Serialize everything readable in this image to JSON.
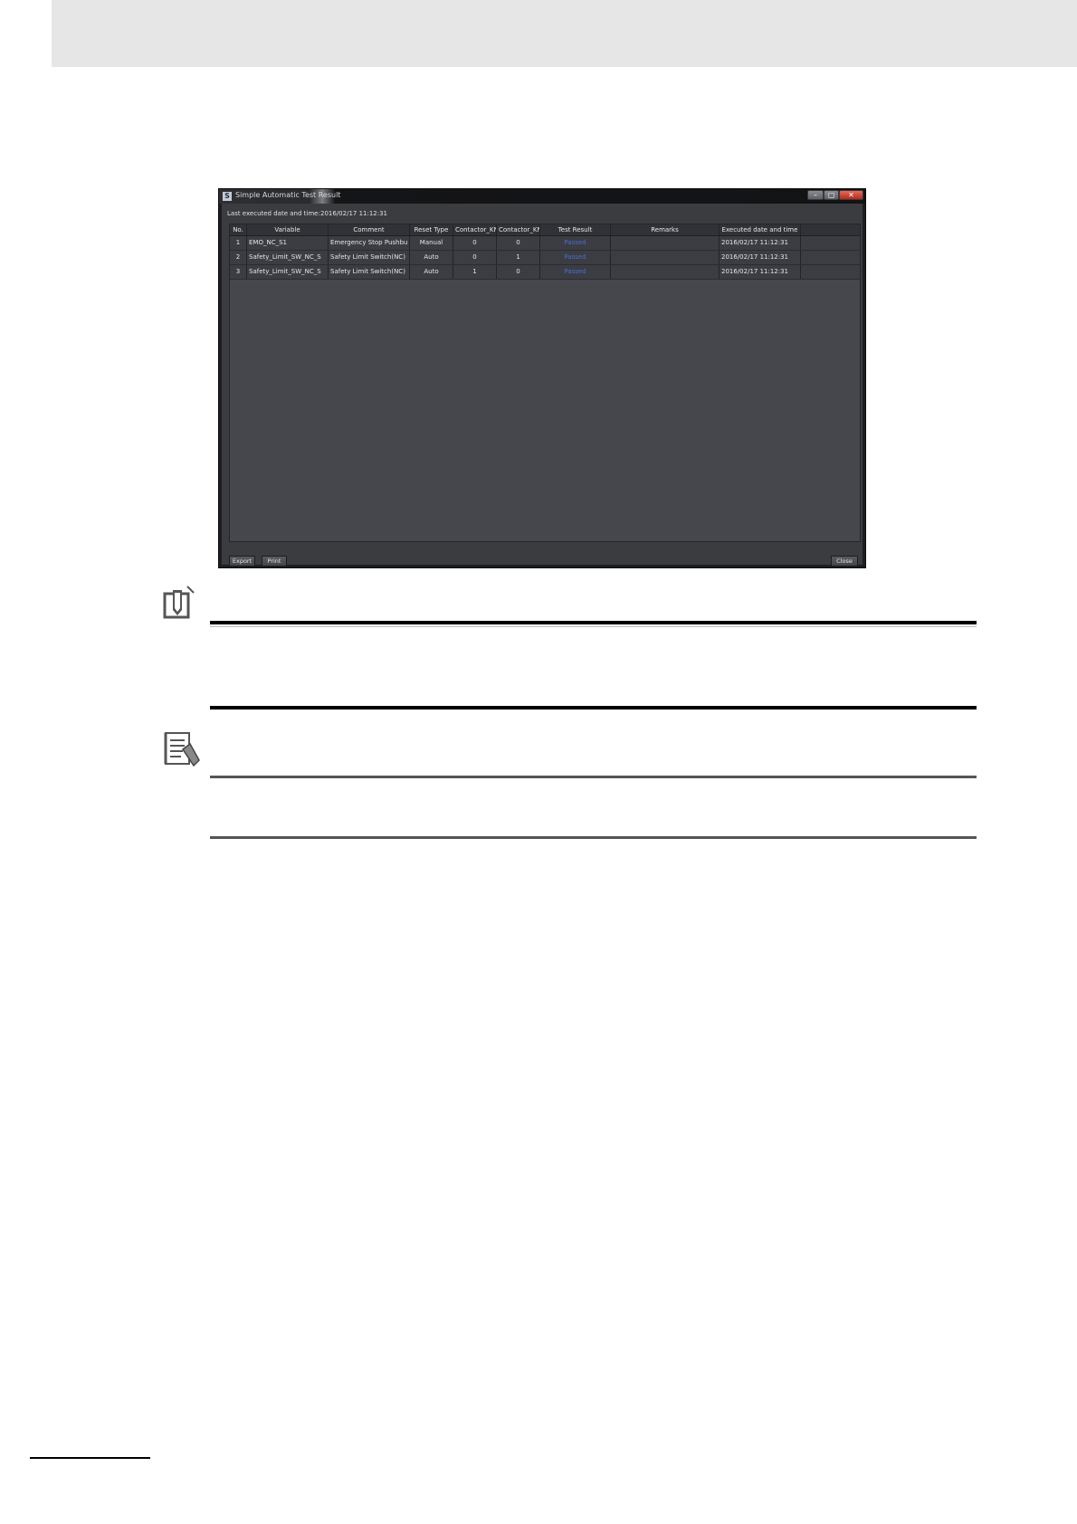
{
  "window": {
    "icon_letter": "S",
    "title": "Simple Automatic Test Result",
    "min_glyph": "–",
    "max_glyph": "▢",
    "close_glyph": "✕"
  },
  "last_executed": {
    "label": "Last executed date and time:",
    "value": "2016/02/17 11:12:31"
  },
  "table": {
    "columns": [
      "No.",
      "Variable",
      "Comment",
      "Reset Type",
      "Contactor_KN",
      "Contactor_KN",
      "Test Result",
      "Remarks",
      "Executed date and time"
    ],
    "rows": [
      [
        "1",
        "EMO_NC_S1",
        "Emergency Stop Pushbu",
        "Manual",
        "0",
        "0",
        "Passed",
        "",
        "2016/02/17 11:12:31"
      ],
      [
        "2",
        "Safety_Limit_SW_NC_S",
        "Safety Limit Switch(NC)",
        "Auto",
        "0",
        "1",
        "Passed",
        "",
        "2016/02/17 11:12:31"
      ],
      [
        "3",
        "Safety_Limit_SW_NC_S",
        "Safety Limit Switch(NC)",
        "Auto",
        "1",
        "0",
        "Passed",
        "",
        "2016/02/17 11:12:31"
      ]
    ]
  },
  "buttons": {
    "export": "Export",
    "print": "Print",
    "close": "Close"
  },
  "icons": {
    "precautions": "precautions-pencil-icon",
    "additional_info": "additional-info-notebook-icon"
  }
}
